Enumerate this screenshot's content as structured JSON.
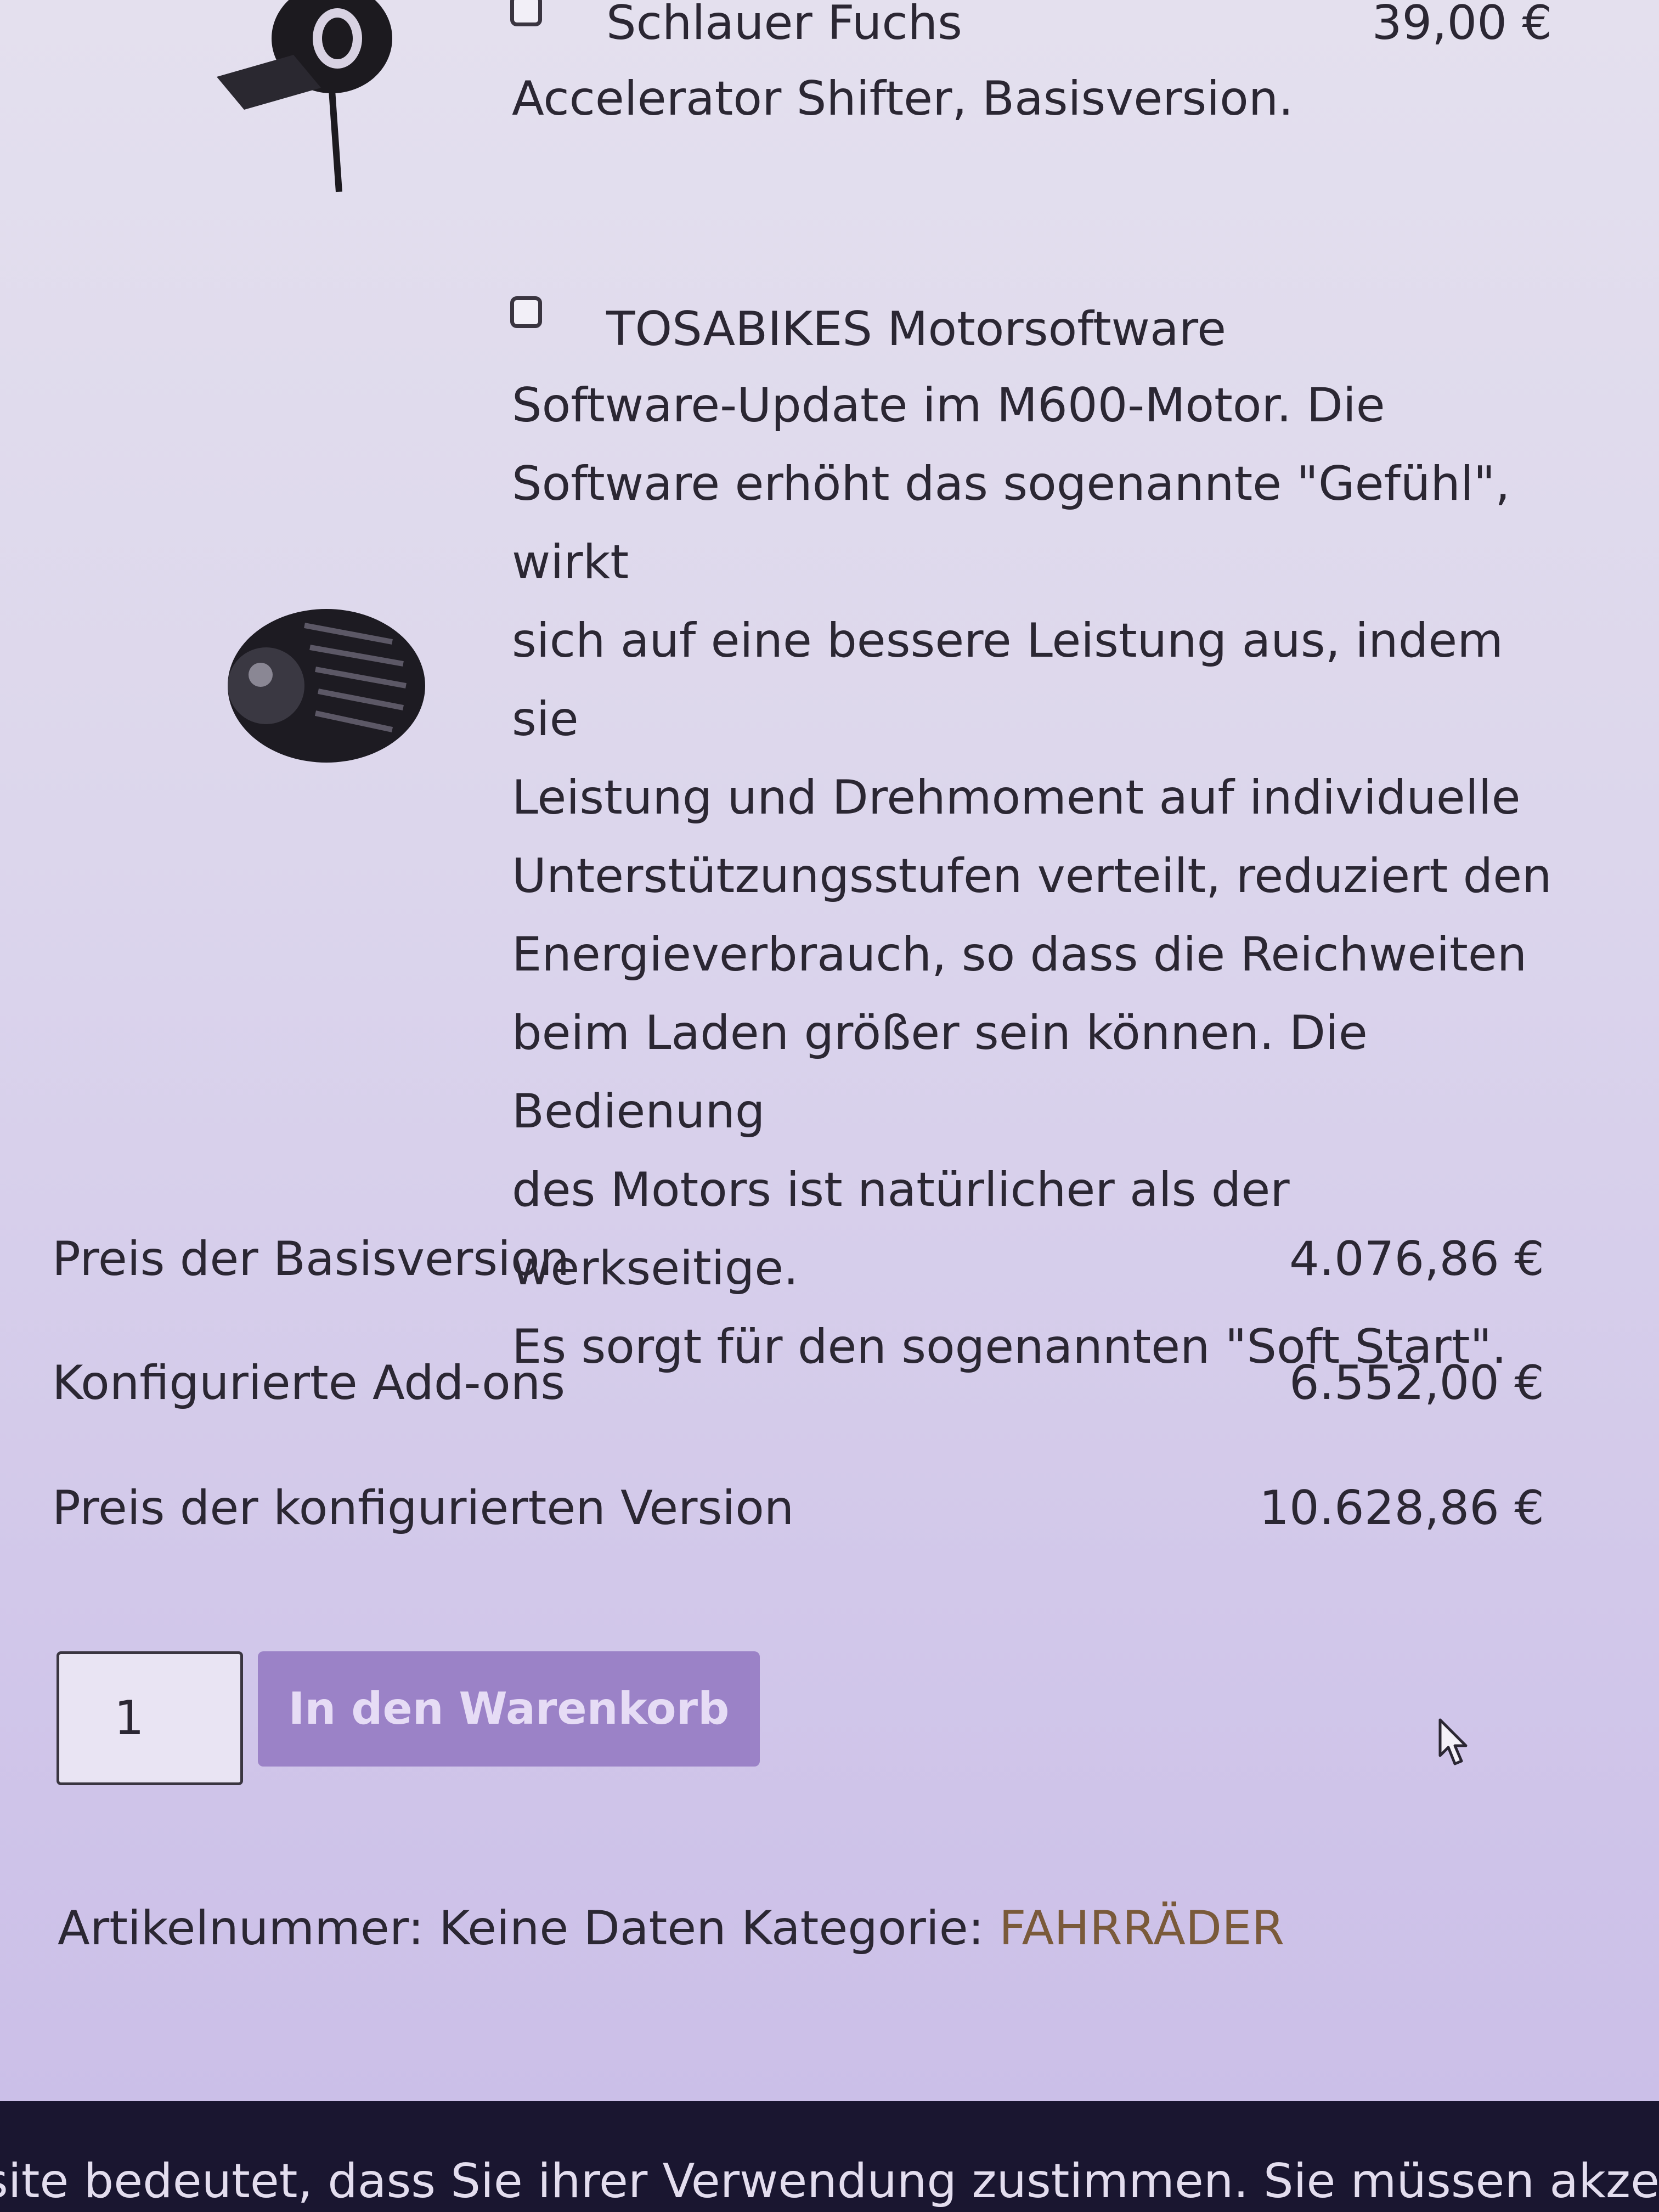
{
  "addons": [
    {
      "name": "Schlauer Fuchs",
      "price": "39,00 €",
      "description": "Accelerator Shifter, Basisversion.",
      "image_icon": "throttle-shifter-icon",
      "checked": false
    },
    {
      "name": "TOSABIKES Motorsoftware",
      "price": "",
      "description": "Software-Update im M600-Motor. Die\nSoftware erhöht das sogenannte \"Gefühl\", wirkt\nsich auf eine bessere Leistung aus, indem sie\nLeistung und Drehmoment auf individuelle\nUnterstützungsstufen verteilt, reduziert den\nEnergieverbrauch, so dass die Reichweiten\nbeim Laden größer sein können. Die Bedienung\ndes Motors ist natürlicher als der werkseitige.\nEs sorgt für den sogenannten \"Soft Start\".",
      "image_icon": "motor-icon",
      "checked": false
    }
  ],
  "summary": {
    "base_label": "Preis der Basisversion",
    "base_value": "4.076,86 €",
    "addons_label": "Konfigurierte Add-ons",
    "addons_value": "6.552,00 €",
    "total_label": "Preis der konfigurierten Version",
    "total_value": "10.628,86 €"
  },
  "cart": {
    "quantity": "1",
    "button_label": "In den Warenkorb"
  },
  "meta": {
    "sku_label": "Artikelnummer:",
    "sku_value": "Keine Daten",
    "category_label": "Kategorie:",
    "category_value": "FAHRRÄDER"
  },
  "cookie_notice": "site bedeutet, dass Sie ihrer Verwendung zustimmen. Sie müssen akzeptieren, den",
  "colors": {
    "button_bg": "#9b82c7",
    "category_link": "#7a5a3a",
    "footer_bg": "#1a1630"
  }
}
